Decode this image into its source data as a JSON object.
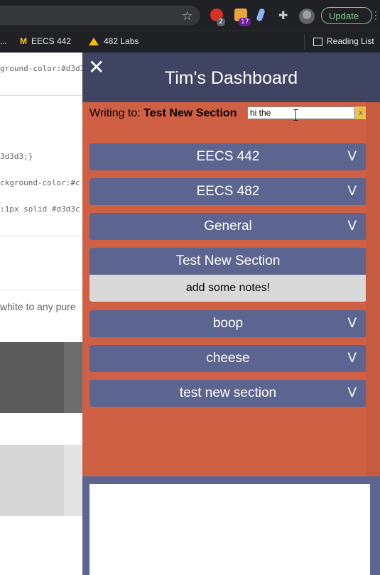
{
  "browser": {
    "update_label": "Update",
    "badge_one": "2",
    "badge_two": "17",
    "bookmarks": [
      "...",
      "EECS 442",
      "482 Labs"
    ],
    "reading_list": "Reading List",
    "michigan_mark": "M"
  },
  "background_page": {
    "code_lines": [
      "ground-color:#d3d3",
      "3d3d3;}",
      "ckground-color:#c",
      ":1px solid #d3d3c"
    ],
    "text": "white to any pure"
  },
  "panel": {
    "close_label": "✕",
    "title": "Tim's Dashboard",
    "writing_prefix": "Writing to:",
    "writing_section": "Test New Section",
    "note_input_value": "hi the",
    "clear_label": "x",
    "sections": [
      {
        "label": "EECS 442",
        "chevron": "V"
      },
      {
        "label": "EECS 482",
        "chevron": "V"
      },
      {
        "label": "General",
        "chevron": "V"
      },
      {
        "label": "Test New Section",
        "chevron": ""
      },
      {
        "label": "boop",
        "chevron": "V"
      },
      {
        "label": "cheese",
        "chevron": "V"
      },
      {
        "label": "test new section",
        "chevron": "V"
      }
    ],
    "open_section_notes": "add some notes!"
  },
  "colors": {
    "panel_header": "#404463",
    "panel_body": "#d06044",
    "section_bar": "#5c6590",
    "notes_box": "#d9d9d9",
    "clear_button": "#e8c34c",
    "update_button": "#81c995"
  },
  "icons": [
    "star-icon",
    "extension-icon",
    "puzzle-icon",
    "profile-avatar",
    "more-icon",
    "bookmark-icon",
    "drive-icon",
    "reading-list-icon",
    "close-icon",
    "chevron-down-icon",
    "text-cursor-icon"
  ]
}
